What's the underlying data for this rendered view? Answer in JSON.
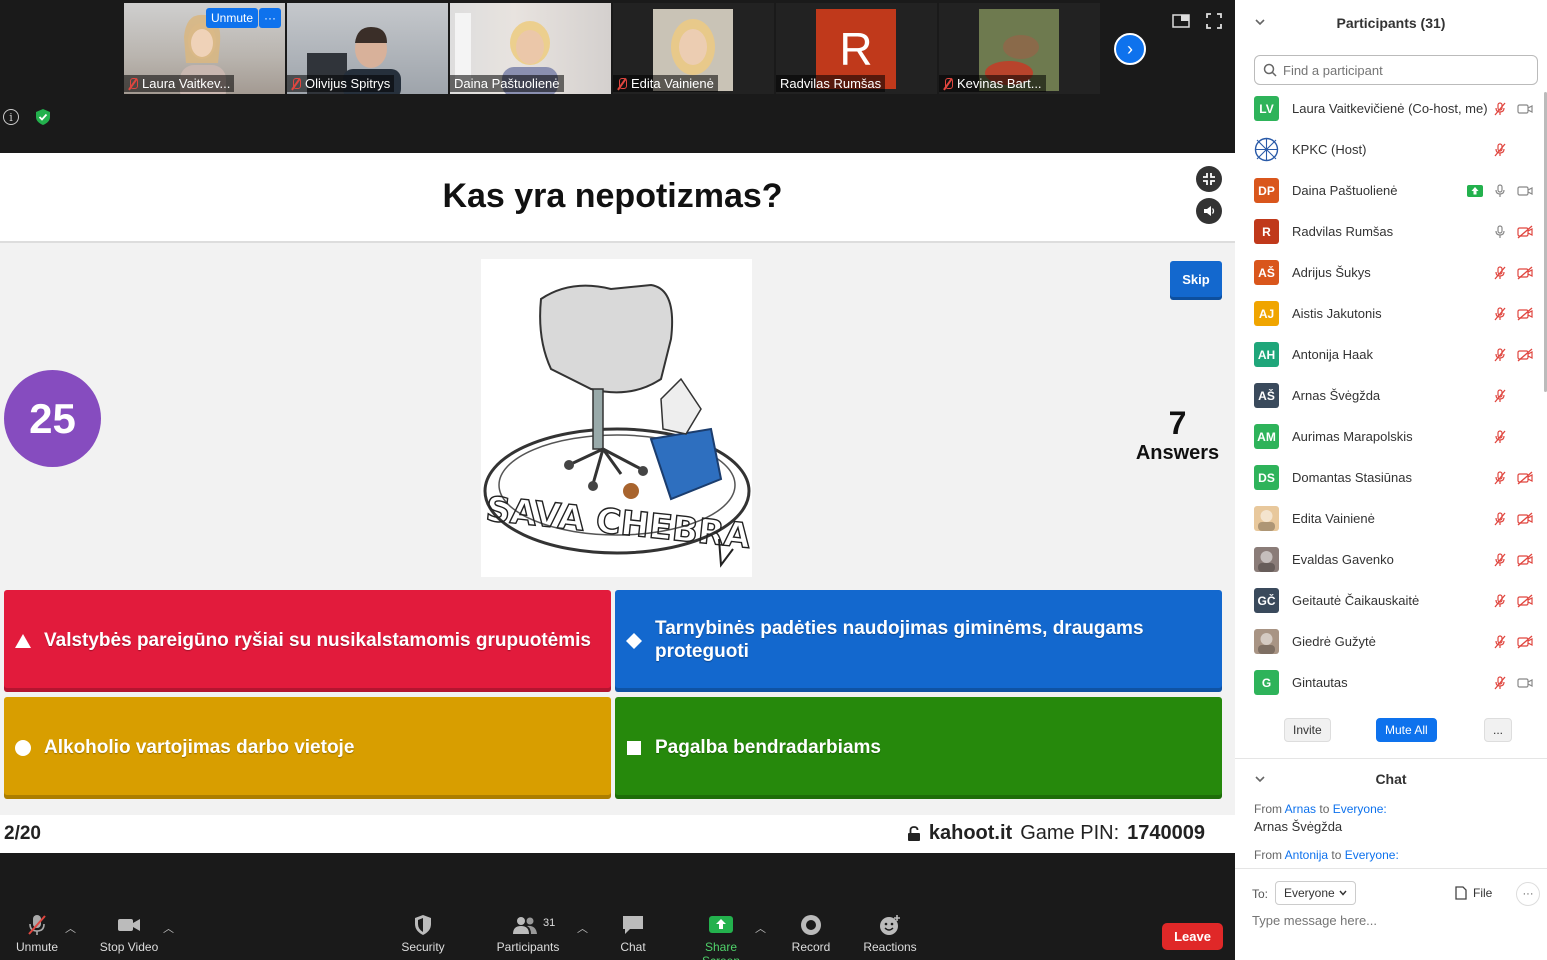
{
  "gallery": {
    "thumbs": [
      {
        "name": "Laura Vaitkev...",
        "muted": true
      },
      {
        "name": "Olivijus Spitrys",
        "muted": true
      },
      {
        "name": "Daina Paštuolienė",
        "muted": false
      },
      {
        "name": "Edita Vainienė",
        "muted": true
      },
      {
        "name": "Radvilas Rumšas",
        "muted": false,
        "initial": "R"
      },
      {
        "name": "Kevinas Bart...",
        "muted": true
      }
    ],
    "unmute_label": "Unmute",
    "more_label": "···",
    "next_arrow": "›"
  },
  "kahoot": {
    "question": "Kas yra nepotizmas?",
    "timer": "25",
    "skip_label": "Skip",
    "answers_count": "7",
    "answers_label": "Answers",
    "image_caption": "SAVA CHEBRA",
    "answers": [
      {
        "text": "Valstybės pareigūno ryšiai su nusikalstamomis grupuotėmis",
        "shape": "triangle",
        "color": "#e21b3c"
      },
      {
        "text": "Tarnybinės padėties naudojimas giminėms, draugams proteguoti",
        "shape": "diamond",
        "color": "#1368ce"
      },
      {
        "text": "Alkoholio vartojimas darbo vietoje",
        "shape": "circle",
        "color": "#d89e00"
      },
      {
        "text": "Pagalba bendradarbiams",
        "shape": "square",
        "color": "#26890c"
      }
    ],
    "counter": "2/20",
    "site": "kahoot.it",
    "pin_label": "Game PIN:",
    "pin": "1740009"
  },
  "toolbar": {
    "unmute": "Unmute",
    "stop_video": "Stop Video",
    "security": "Security",
    "participants": "Participants",
    "participants_count": "31",
    "chat": "Chat",
    "share_screen": "Share Screen",
    "record": "Record",
    "reactions": "Reactions",
    "leave": "Leave"
  },
  "participants_panel": {
    "title": "Participants (31)",
    "search_placeholder": "Find a participant",
    "list": [
      {
        "initials": "LV",
        "name": "Laura Vaitkevičienė (Co-host, me)",
        "color": "#2eb35a",
        "mic": "off",
        "cam": "on"
      },
      {
        "initials": "",
        "name": "KPKC (Host)",
        "color": "#ffffff",
        "mic": "off",
        "cam": "none",
        "logo": true
      },
      {
        "initials": "DP",
        "name": "Daina Paštuolienė",
        "color": "#d9561c",
        "mic": "on",
        "cam": "on",
        "sharing": true
      },
      {
        "initials": "R",
        "name": "Radvilas Rumšas",
        "color": "#c0391b",
        "mic": "on",
        "cam": "off"
      },
      {
        "initials": "AŠ",
        "name": "Adrijus Šukys",
        "color": "#d9561c",
        "mic": "off",
        "cam": "off"
      },
      {
        "initials": "AJ",
        "name": "Aistis Jakutonis",
        "color": "#f0a500",
        "mic": "off",
        "cam": "off"
      },
      {
        "initials": "AH",
        "name": "Antonija Haak",
        "color": "#1fa67a",
        "mic": "off",
        "cam": "off"
      },
      {
        "initials": "AŠ",
        "name": "Arnas Švėgžda",
        "color": "#3a4a5c",
        "mic": "off",
        "cam": "none"
      },
      {
        "initials": "AM",
        "name": "Aurimas Marapolskis",
        "color": "#2eb35a",
        "mic": "off",
        "cam": "none"
      },
      {
        "initials": "DS",
        "name": "Domantas Stasiūnas",
        "color": "#2eb35a",
        "mic": "off",
        "cam": "off"
      },
      {
        "initials": "",
        "name": "Edita Vainienė",
        "color": "#e8c89c",
        "mic": "off",
        "cam": "off",
        "photo": true
      },
      {
        "initials": "",
        "name": "Evaldas Gavenko",
        "color": "#8a7c78",
        "mic": "off",
        "cam": "off",
        "photo": true
      },
      {
        "initials": "GČ",
        "name": "Geitautė Čaikauskaitė",
        "color": "#3a4a5c",
        "mic": "off",
        "cam": "off"
      },
      {
        "initials": "",
        "name": "Giedrė Gužytė",
        "color": "#a89484",
        "mic": "off",
        "cam": "off",
        "photo": true
      },
      {
        "initials": "G",
        "name": "Gintautas",
        "color": "#2eb35a",
        "mic": "off",
        "cam": "on"
      }
    ],
    "invite": "Invite",
    "mute_all": "Mute All",
    "more": "..."
  },
  "chat_panel": {
    "title": "Chat",
    "messages": [
      {
        "from_label": "From",
        "from": "Arnas",
        "to_label": "to",
        "to": "Everyone:",
        "body": "Arnas Švėgžda"
      },
      {
        "from_label": "From",
        "from": "Antonija",
        "to_label": "to",
        "to": "Everyone:",
        "body": ""
      }
    ],
    "to_label": "To:",
    "to_value": "Everyone",
    "file_label": "File",
    "more": "···",
    "input_placeholder": "Type message here..."
  }
}
